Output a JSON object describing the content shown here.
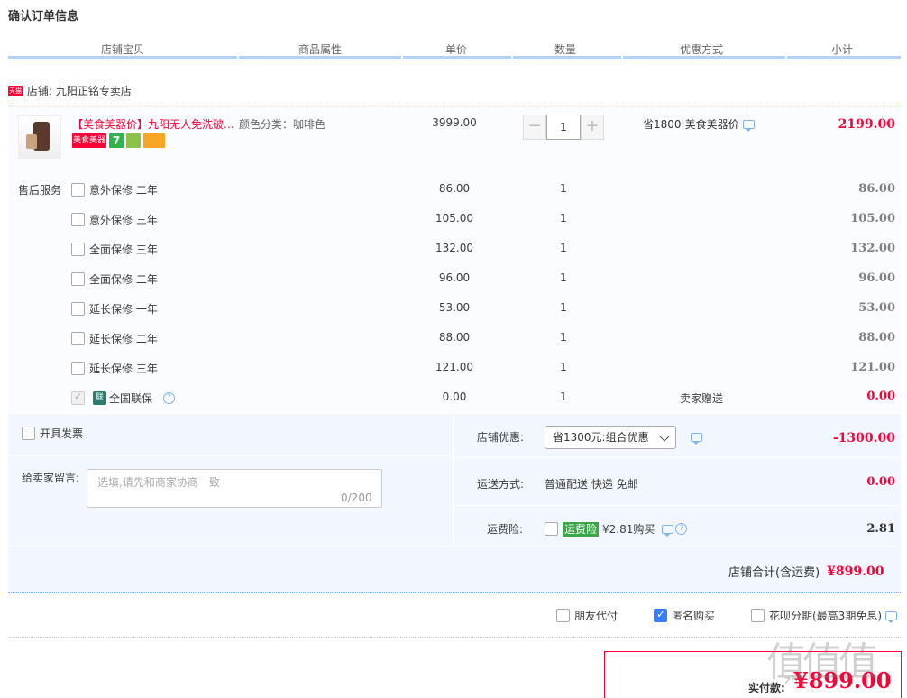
{
  "page_title": "确认订单信息",
  "columns": [
    "店铺宝贝",
    "商品属性",
    "单价",
    "数量",
    "优惠方式",
    "小计"
  ],
  "shop": {
    "badge": "天猫",
    "label": "店铺: 九阳正铭专卖店"
  },
  "product": {
    "title": "【美食美器价】九阳无人免洗破...",
    "attr": "颜色分类：咖啡色",
    "price": "3999.00",
    "quantity": "1",
    "promo": "省1800:美食美器价",
    "subtotal": "2199.00",
    "badges": [
      {
        "text": "美食美器",
        "color": "#ff0036"
      },
      {
        "text": "7",
        "color": "#2fb34a"
      },
      {
        "text": "",
        "color": "#8bc34a"
      },
      {
        "text": "",
        "color": "#f5a623"
      }
    ],
    "qty_minus": "−",
    "qty_plus": "+"
  },
  "services": {
    "label": "售后服务",
    "items": [
      {
        "name": "意外保修 二年",
        "price": "86.00",
        "qty": "1",
        "subtotal": "86.00"
      },
      {
        "name": "意外保修 三年",
        "price": "105.00",
        "qty": "1",
        "subtotal": "105.00"
      },
      {
        "name": "全面保修 三年",
        "price": "132.00",
        "qty": "1",
        "subtotal": "132.00"
      },
      {
        "name": "全面保修 二年",
        "price": "96.00",
        "qty": "1",
        "subtotal": "96.00"
      },
      {
        "name": "延长保修 一年",
        "price": "53.00",
        "qty": "1",
        "subtotal": "53.00"
      },
      {
        "name": "延长保修 二年",
        "price": "88.00",
        "qty": "1",
        "subtotal": "88.00"
      },
      {
        "name": "延长保修 三年",
        "price": "121.00",
        "qty": "1",
        "subtotal": "121.00"
      }
    ],
    "national": {
      "icon": "联",
      "name": "全国联保",
      "price": "0.00",
      "qty": "1",
      "promo": "卖家赠送",
      "subtotal": "0.00"
    }
  },
  "invoice": {
    "label": "开具发票"
  },
  "message": {
    "label": "给卖家留言:",
    "placeholder": "选填,请先和商家协商一致",
    "count": "0/200"
  },
  "shop_discount": {
    "label": "店铺优惠:",
    "selected": "省1300元:组合优惠",
    "amount": "-1300.00"
  },
  "shipping": {
    "label": "运送方式:",
    "value": "普通配送 快递 免邮",
    "amount": "0.00"
  },
  "insurance": {
    "label": "运费险:",
    "tag": "运费险",
    "text": "¥2.81购买",
    "amount": "2.81"
  },
  "shop_total": {
    "label": "店铺合计(含运费)",
    "amount": "¥899.00"
  },
  "options": [
    {
      "label": "朋友代付",
      "checked": false
    },
    {
      "label": "匿名购买",
      "checked": true
    },
    {
      "label": "花呗分期(最高3期免息)",
      "checked": false
    }
  ],
  "payment": {
    "label": "实付款:",
    "amount": "¥899.00"
  },
  "watermark": {
    "text": "值值值",
    "url": "zhi"
  }
}
